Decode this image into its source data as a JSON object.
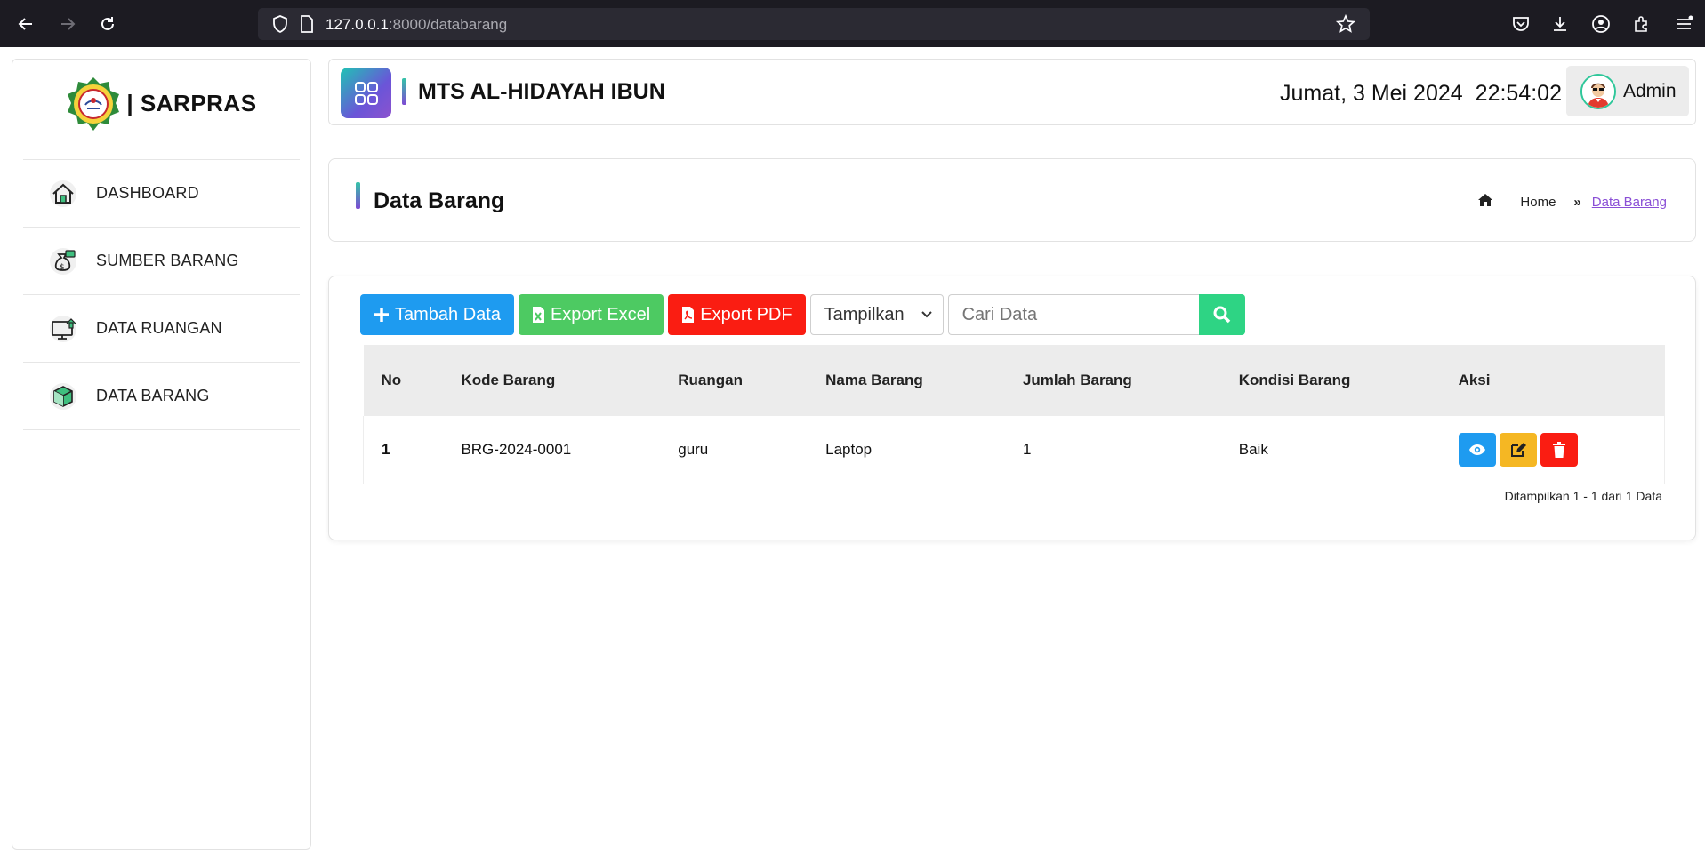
{
  "browser": {
    "url_host": "127.0.0.1",
    "url_rest": ":8000/databarang"
  },
  "sidebar": {
    "brand": "| SARPRAS",
    "items": [
      {
        "label": "DASHBOARD",
        "icon": "home-icon"
      },
      {
        "label": "SUMBER BARANG",
        "icon": "money-bag-icon"
      },
      {
        "label": "DATA RUANGAN",
        "icon": "monitor-upload-icon"
      },
      {
        "label": "DATA BARANG",
        "icon": "box-icon"
      }
    ]
  },
  "header": {
    "school": "MTS AL-HIDAYAH IBUN",
    "date": "Jumat, 3 Mei 2024",
    "time": "22:54:02",
    "user": "Admin"
  },
  "page": {
    "title": "Data Barang",
    "breadcrumb": {
      "home": "Home",
      "current": "Data Barang"
    }
  },
  "toolbar": {
    "add_label": "Tambah Data",
    "excel_label": "Export Excel",
    "pdf_label": "Export PDF",
    "show_label": "Tampilkan",
    "search_placeholder": "Cari Data"
  },
  "table": {
    "headers": [
      "No",
      "Kode Barang",
      "Ruangan",
      "Nama Barang",
      "Jumlah Barang",
      "Kondisi Barang",
      "Aksi"
    ],
    "rows": [
      {
        "no": "1",
        "kode": "BRG-2024-0001",
        "ruangan": "guru",
        "nama": "Laptop",
        "jumlah": "1",
        "kondisi": "Baik"
      }
    ],
    "summary": "Ditampilkan 1 - 1 dari 1 Data"
  },
  "colors": {
    "primary": "#1e9bf0",
    "success": "#4dca62",
    "danger": "#fa1d12",
    "warning": "#f5b723",
    "search": "#2ed484",
    "accent": "#8a4fd6"
  }
}
